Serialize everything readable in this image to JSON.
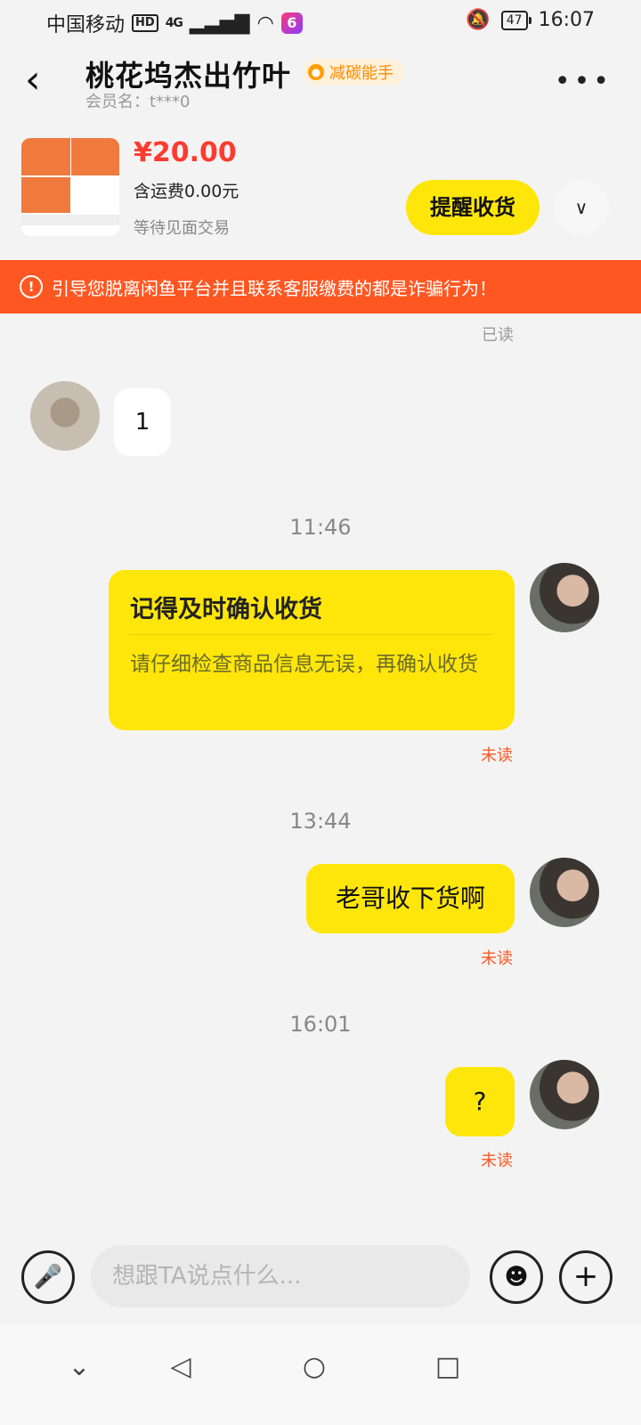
{
  "status_bar": {
    "carrier": "中国移动",
    "hd": "HD",
    "network": "4G",
    "app_badge": "6",
    "battery": "47",
    "time": "16:07"
  },
  "header": {
    "title": "桃花坞杰出竹叶",
    "badge": "减碳能手",
    "member": "会员名：t***0"
  },
  "product": {
    "price": "¥20.00",
    "shipping": "含运费0.00元",
    "status": "等待见面交易",
    "remind_button": "提醒收货"
  },
  "warning": "引导您脱离闲鱼平台并且联系客服缴费的都是诈骗行为！",
  "messages": {
    "top_read": "已读",
    "incoming_text": "1",
    "time1": "11:46",
    "card_title": "记得及时确认收货",
    "card_text": "请仔细检查商品信息无误，再确认收货",
    "card_status": "未读",
    "time2": "13:44",
    "msg2": "老哥收下货啊",
    "msg2_status": "未读",
    "time3": "16:01",
    "msg3": "?",
    "msg3_status": "未读"
  },
  "input": {
    "placeholder": "想跟TA说点什么..."
  },
  "colors": {
    "accent_yellow": "#ffe60a",
    "warning_orange": "#ff5722",
    "price_red": "#ff3b30"
  }
}
